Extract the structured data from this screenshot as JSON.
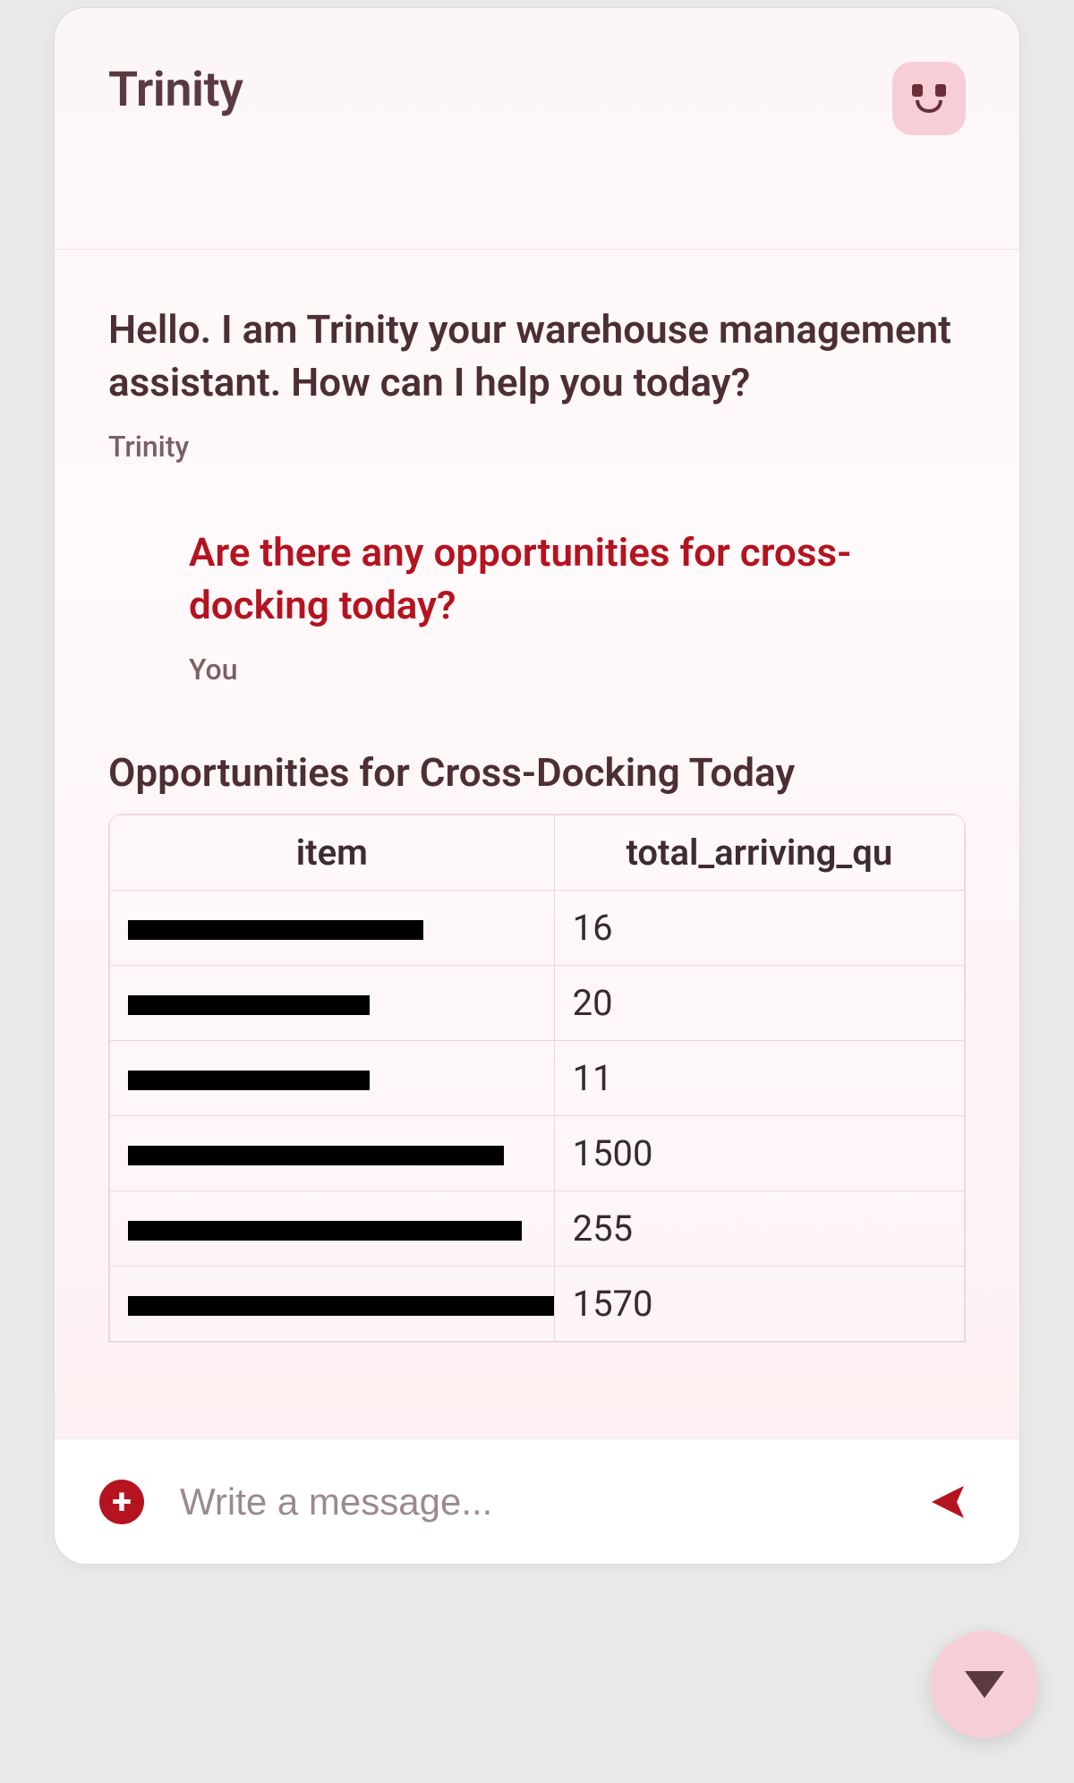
{
  "header": {
    "title": "Trinity"
  },
  "messages": {
    "assistant_intro": {
      "text": "Hello. I am Trinity your warehouse management assistant. How can I help you today?",
      "sender": "Trinity"
    },
    "user_query": {
      "text": "Are there any opportunities for cross-docking today?",
      "sender": "You"
    }
  },
  "result": {
    "title": "Opportunities for Cross-Docking Today",
    "columns": {
      "item": "item",
      "qty": "total_arriving_qu"
    },
    "rows": [
      {
        "redact_w": 330,
        "qty": "16"
      },
      {
        "redact_w": 270,
        "qty": "20"
      },
      {
        "redact_w": 270,
        "qty": "11"
      },
      {
        "redact_w": 420,
        "qty": "1500"
      },
      {
        "redact_w": 440,
        "qty": "255"
      },
      {
        "redact_w": 490,
        "qty": "1570"
      }
    ]
  },
  "composer": {
    "placeholder": "Write a message..."
  }
}
